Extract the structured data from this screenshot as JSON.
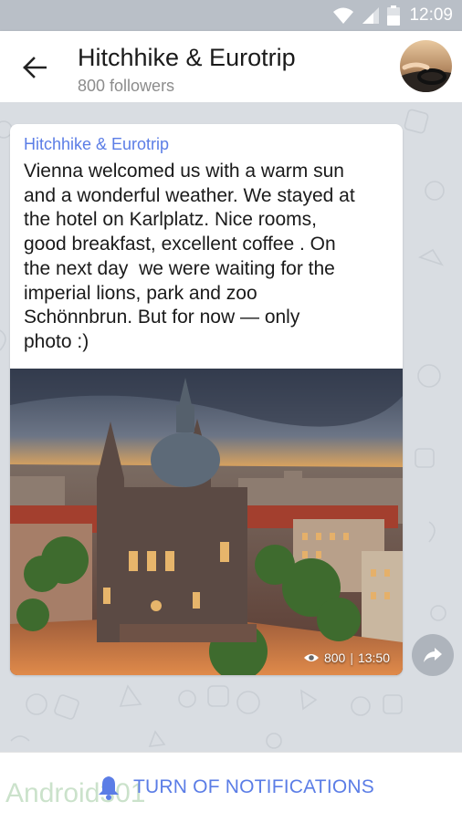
{
  "status_bar": {
    "time": "12:09",
    "icons": [
      "wifi-icon",
      "signal-icon",
      "battery-icon"
    ]
  },
  "header": {
    "back_icon": "arrow-left-icon",
    "title": "Hitchhike & Eurotrip",
    "subtitle": "800 followers"
  },
  "message": {
    "author": "Hitchhike & Eurotrip",
    "text_lines": [
      "Vienna welcomed us with a warm sun",
      "and a wonderful weather. We stayed at",
      "the hotel on Karlplatz. Nice rooms,",
      "good breakfast, excellent coffee . On",
      "the next day  we were waiting for the",
      "imperial lions, park and zoo",
      "Schönnbrun. But for now — only",
      "photo :)"
    ],
    "views": "800",
    "time": "13:50",
    "share_icon": "share-icon"
  },
  "bottom": {
    "notification_label": "TURN OF NOTIFICATIONS",
    "bell_icon": "bell-icon",
    "watermark": "Android301"
  },
  "colors": {
    "accent": "#5b7de6",
    "status_bar": "#b9bfc7",
    "chat_background": "#d9dde2"
  }
}
